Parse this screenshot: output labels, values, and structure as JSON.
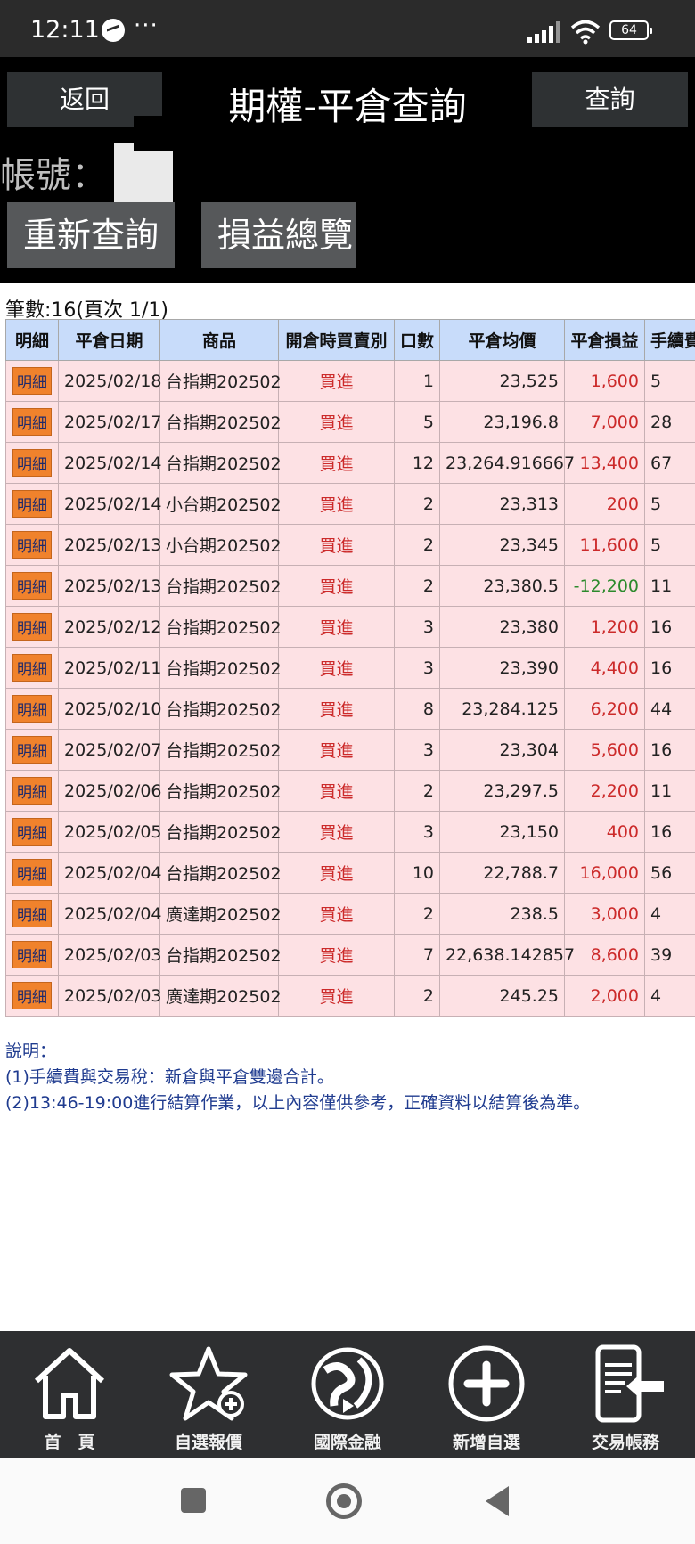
{
  "status_bar": {
    "time": "12:11",
    "dots": "···",
    "battery": "64"
  },
  "header": {
    "back_label": "返回",
    "title": "期權-平倉查詢",
    "query_label": "查詢",
    "account_label": "帳號：",
    "requery_label": "重新查詢",
    "pnl_summary_label": "損益總覽"
  },
  "records_info": "筆數:16(頁次 1/1)",
  "table": {
    "columns": [
      "明細",
      "平倉日期",
      "商品",
      "開倉時買賣別",
      "口數",
      "平倉均價",
      "平倉損益",
      "手續費"
    ],
    "detail_label": "明細",
    "rows": [
      {
        "date": "2025/02/18",
        "product": "台指期202502",
        "side": "買進",
        "qty": "1",
        "price": "23,525",
        "pnl": "1,600",
        "fee": "5"
      },
      {
        "date": "2025/02/17",
        "product": "台指期202502",
        "side": "買進",
        "qty": "5",
        "price": "23,196.8",
        "pnl": "7,000",
        "fee": "28"
      },
      {
        "date": "2025/02/14",
        "product": "台指期202502",
        "side": "買進",
        "qty": "12",
        "price": "23,264.916667",
        "pnl": "13,400",
        "fee": "67"
      },
      {
        "date": "2025/02/14",
        "product": "小台期202502",
        "side": "買進",
        "qty": "2",
        "price": "23,313",
        "pnl": "200",
        "fee": "5"
      },
      {
        "date": "2025/02/13",
        "product": "小台期202502",
        "side": "買進",
        "qty": "2",
        "price": "23,345",
        "pnl": "11,600",
        "fee": "5"
      },
      {
        "date": "2025/02/13",
        "product": "台指期202502",
        "side": "買進",
        "qty": "2",
        "price": "23,380.5",
        "pnl": "-12,200",
        "fee": "11"
      },
      {
        "date": "2025/02/12",
        "product": "台指期202502",
        "side": "買進",
        "qty": "3",
        "price": "23,380",
        "pnl": "1,200",
        "fee": "16"
      },
      {
        "date": "2025/02/11",
        "product": "台指期202502",
        "side": "買進",
        "qty": "3",
        "price": "23,390",
        "pnl": "4,400",
        "fee": "16"
      },
      {
        "date": "2025/02/10",
        "product": "台指期202502",
        "side": "買進",
        "qty": "8",
        "price": "23,284.125",
        "pnl": "6,200",
        "fee": "44"
      },
      {
        "date": "2025/02/07",
        "product": "台指期202502",
        "side": "買進",
        "qty": "3",
        "price": "23,304",
        "pnl": "5,600",
        "fee": "16"
      },
      {
        "date": "2025/02/06",
        "product": "台指期202502",
        "side": "買進",
        "qty": "2",
        "price": "23,297.5",
        "pnl": "2,200",
        "fee": "11"
      },
      {
        "date": "2025/02/05",
        "product": "台指期202502",
        "side": "買進",
        "qty": "3",
        "price": "23,150",
        "pnl": "400",
        "fee": "16"
      },
      {
        "date": "2025/02/04",
        "product": "台指期202502",
        "side": "買進",
        "qty": "10",
        "price": "22,788.7",
        "pnl": "16,000",
        "fee": "56"
      },
      {
        "date": "2025/02/04",
        "product": "廣達期202502",
        "side": "買進",
        "qty": "2",
        "price": "238.5",
        "pnl": "3,000",
        "fee": "4"
      },
      {
        "date": "2025/02/03",
        "product": "台指期202502",
        "side": "買進",
        "qty": "7",
        "price": "22,638.142857",
        "pnl": "8,600",
        "fee": "39"
      },
      {
        "date": "2025/02/03",
        "product": "廣達期202502",
        "side": "買進",
        "qty": "2",
        "price": "245.25",
        "pnl": "2,000",
        "fee": "4"
      }
    ]
  },
  "notes": {
    "heading": "說明：",
    "line1": "(1)手續費與交易稅：新倉與平倉雙邊合計。",
    "line2": "(2)13:46-19:00進行結算作業，以上內容僅供參考，正確資料以結算後為準。"
  },
  "bottom_nav": [
    {
      "label": "首　頁",
      "icon": "home-icon"
    },
    {
      "label": "自選報價",
      "icon": "star-plus-icon"
    },
    {
      "label": "國際金融",
      "icon": "globe-icon"
    },
    {
      "label": "新增自選",
      "icon": "circle-plus-icon"
    },
    {
      "label": "交易帳務",
      "icon": "phone-trade-icon"
    }
  ],
  "colors": {
    "header_bg": "#000000",
    "table_header_bg": "#c8dcfa",
    "row_bg": "#fde1e4",
    "positive": "#cc2a2a",
    "negative": "#2c8a2c",
    "detail_button": "#f0822c",
    "note_text": "#1f3b8f",
    "nav_bg": "#2e2f31"
  }
}
